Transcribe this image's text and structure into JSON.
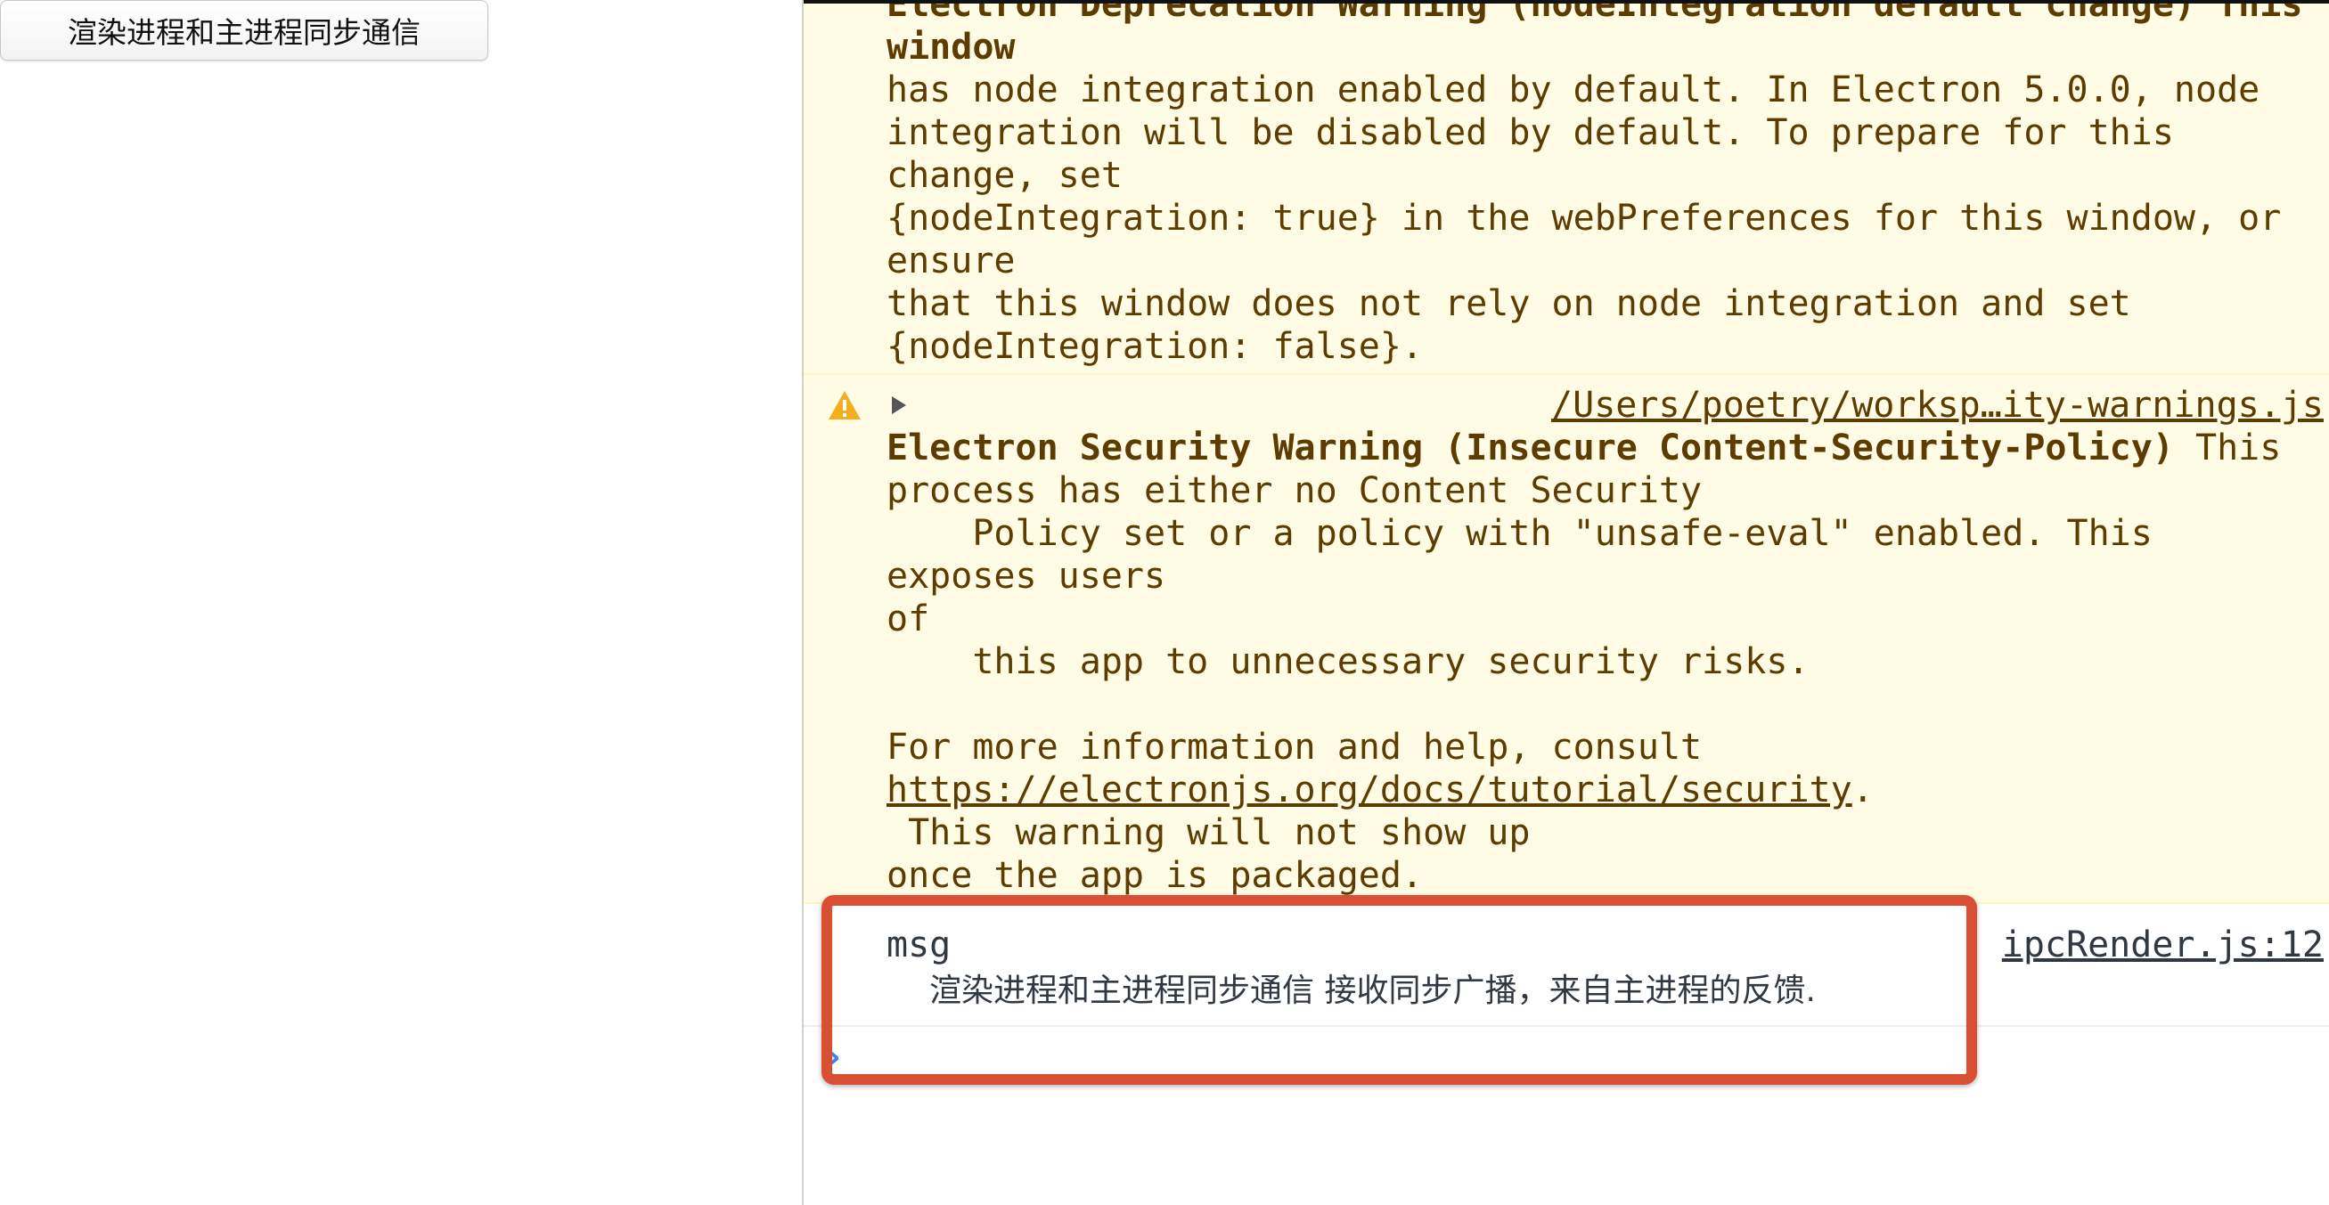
{
  "page": {
    "button_label": "渲染进程和主进程同步通信"
  },
  "console": {
    "warning1_lines": [
      "Electron Deprecation Warning (nodeIntegration default change) This window",
      "has node integration enabled by default. In Electron 5.0.0, node",
      "integration will be disabled by default. To prepare for this change, set",
      "{nodeIntegration: true} in the webPreferences for this window, or ensure",
      "that this window does not rely on node integration and set",
      "{nodeIntegration: false}."
    ],
    "warning2": {
      "icon": "warning-triangle-icon",
      "source": "/Users/poetry/worksp…ity-warnings.js",
      "title": "Electron Security Warning (Insecure Content-Security-Policy)",
      "title_tail": " This",
      "lines": [
        "process has either no Content Security",
        "    Policy set or a policy with \"unsafe-eval\" enabled. This exposes users",
        "of",
        "    this app to unnecessary security risks.",
        "",
        "For more information and help, consult"
      ],
      "link": "https://electronjs.org/docs/tutorial/security",
      "after_link": ".",
      "lines2": [
        " This warning will not show up",
        "once the app is packaged."
      ]
    },
    "log": {
      "label": "msg",
      "value": "渲染进程和主进程同步通信 接收同步广播，来自主进程的反馈.",
      "source": "ipcRender.js:12"
    },
    "prompt_symbol": "›"
  },
  "colors": {
    "warning_bg": "#fffbe5",
    "warning_text": "#5c3c00",
    "highlight": "#d94f33",
    "prompt": "#4a7ef0"
  }
}
